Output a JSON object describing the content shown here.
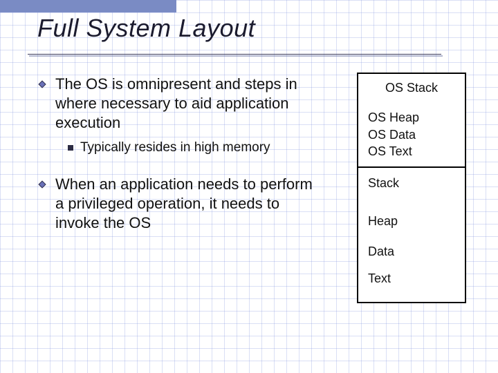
{
  "title": "Full System Layout",
  "bullets": {
    "b1": "The OS is omnipresent and steps in where necessary to aid application execution",
    "b1_sub": "Typically resides in high memory",
    "b2": "When an application needs to perform a privileged operation, it needs to invoke the OS"
  },
  "diagram": {
    "os_stack": "OS Stack",
    "os_heap": "OS Heap",
    "os_data": "OS Data",
    "os_text": "OS Text",
    "stack": "Stack",
    "heap": "Heap",
    "data": "Data",
    "text": "Text"
  }
}
